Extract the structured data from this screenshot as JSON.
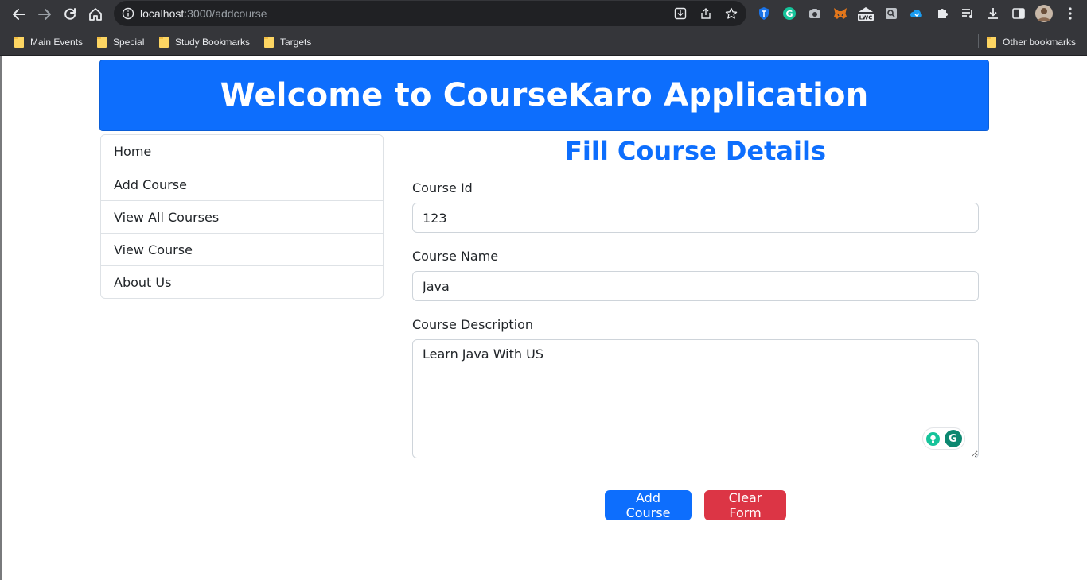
{
  "browser": {
    "url_host": "localhost",
    "url_path": ":3000/addcourse",
    "bookmarks": [
      "Main Events",
      "Special",
      "Study Bookmarks",
      "Targets"
    ],
    "other_bookmarks": "Other bookmarks",
    "extension_labels": {
      "lwc": "LWC"
    }
  },
  "header": {
    "title": "Welcome to CourseKaro Application"
  },
  "sidebar": {
    "items": [
      {
        "label": "Home"
      },
      {
        "label": "Add Course"
      },
      {
        "label": "View All Courses"
      },
      {
        "label": "View Course"
      },
      {
        "label": "About Us"
      }
    ]
  },
  "form": {
    "title": "Fill Course Details",
    "course_id": {
      "label": "Course Id",
      "value": "123"
    },
    "course_name": {
      "label": "Course Name",
      "value": "Java"
    },
    "course_description": {
      "label": "Course Description",
      "value": "Learn Java With US"
    },
    "add_button": "Add Course",
    "clear_button": "Clear Form"
  },
  "colors": {
    "primary": "#0d6efd",
    "danger": "#dc3545",
    "chrome_bg": "#35363a",
    "omnibox_bg": "#202124",
    "grammarly": "#0b8770"
  }
}
